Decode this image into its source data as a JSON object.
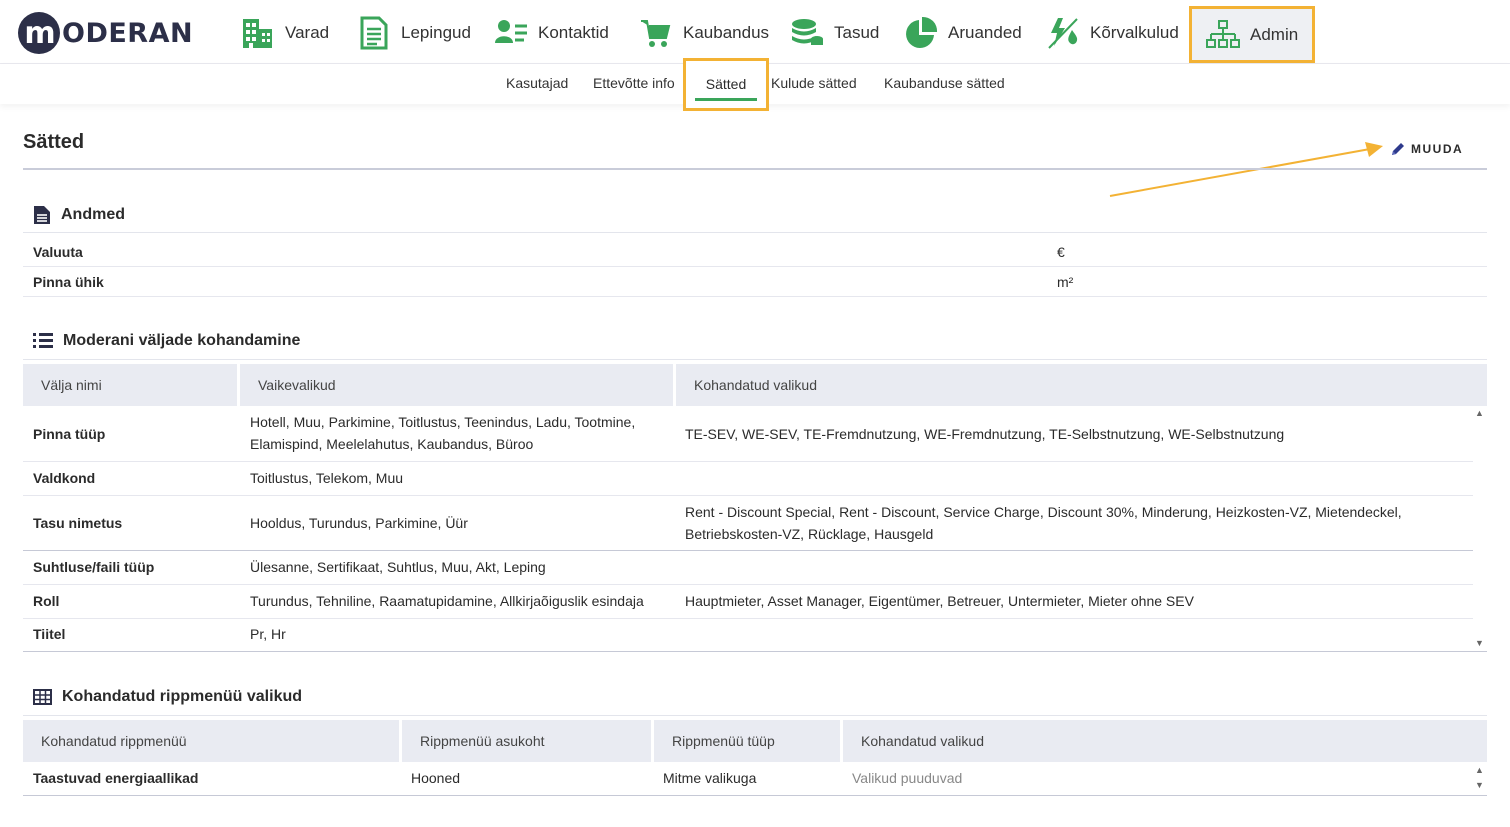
{
  "brand": {
    "logo_letter": "m",
    "logo_text": "ODERAN"
  },
  "nav": {
    "items": [
      {
        "label": "Varad",
        "icon": "building-icon"
      },
      {
        "label": "Lepingud",
        "icon": "document-icon"
      },
      {
        "label": "Kontaktid",
        "icon": "contact-card-icon"
      },
      {
        "label": "Kaubandus",
        "icon": "shopping-cart-icon"
      },
      {
        "label": "Tasud",
        "icon": "coins-icon"
      },
      {
        "label": "Aruanded",
        "icon": "pie-chart-icon"
      },
      {
        "label": "Kõrvalkulud",
        "icon": "utilities-icon"
      },
      {
        "label": "Admin",
        "icon": "org-chart-icon"
      }
    ],
    "accent": "#3aa55a",
    "highlight": "#f3b234"
  },
  "subnav": {
    "items": [
      "Kasutajad",
      "Ettevõtte info",
      "Sätted",
      "Kulude sätted",
      "Kaubanduse sätted"
    ],
    "active": "Sätted"
  },
  "page": {
    "title": "Sätted",
    "edit_label": "MUUDA"
  },
  "andmed": {
    "heading": "Andmed",
    "rows": [
      {
        "key": "Valuuta",
        "value": "€"
      },
      {
        "key": "Pinna ühik",
        "value": "m²"
      }
    ]
  },
  "fields": {
    "heading": "Moderani väljade kohandamine",
    "columns": [
      "Välja nimi",
      "Vaikevalikud",
      "Kohandatud valikud"
    ],
    "rows": [
      {
        "name": "Pinna tüüp",
        "defaults": "Hotell, Muu, Parkimine, Toitlustus, Teenindus, Ladu, Tootmine, Elamispind, Meelelahutus, Kaubandus, Büroo",
        "custom": "TE-SEV, WE-SEV, TE-Fremdnutzung, WE-Fremdnutzung, TE-Selbstnutzung, WE-Selbstnutzung"
      },
      {
        "name": "Valdkond",
        "defaults": "Toitlustus, Telekom, Muu",
        "custom": ""
      },
      {
        "name": "Tasu nimetus",
        "defaults": "Hooldus, Turundus, Parkimine, Üür",
        "custom": "Rent - Discount Special, Rent - Discount, Service Charge, Discount 30%, Minderung, Heizkosten-VZ, Mietendeckel, Betriebskosten-VZ, Rücklage, Hausgeld"
      },
      {
        "name": "Suhtluse/faili tüüp",
        "defaults": "Ülesanne, Sertifikaat, Suhtlus, Muu, Akt, Leping",
        "custom": ""
      },
      {
        "name": "Roll",
        "defaults": "Turundus, Tehniline, Raamatupidamine, Allkirjaõiguslik esindaja",
        "custom": "Hauptmieter, Asset Manager, Eigentümer, Betreuer, Untermieter, Mieter ohne SEV"
      },
      {
        "name": "Tiitel",
        "defaults": "Pr, Hr",
        "custom": ""
      }
    ]
  },
  "dropdowns": {
    "heading": "Kohandatud rippmenüü valikud",
    "columns": [
      "Kohandatud rippmenüü",
      "Rippmenüü asukoht",
      "Rippmenüü tüüp",
      "Kohandatud valikud"
    ],
    "rows": [
      {
        "name": "Taastuvad energiaallikad",
        "location": "Hooned",
        "type": "Mitme valikuga",
        "options": "Valikud puuduvad"
      }
    ]
  }
}
